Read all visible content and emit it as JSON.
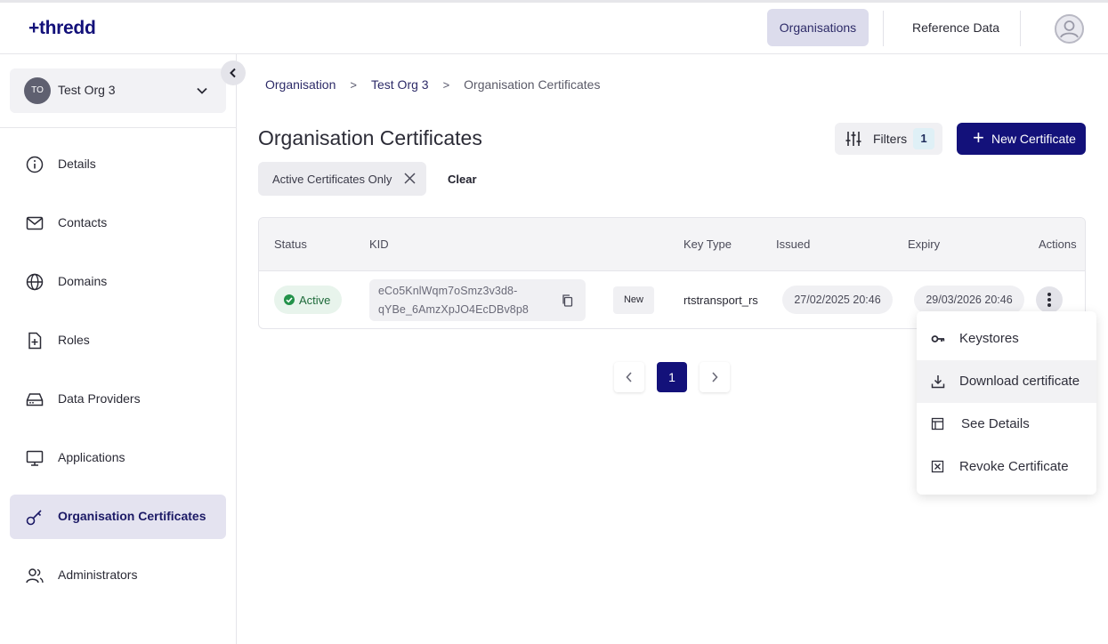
{
  "header": {
    "logo": "+thredd",
    "nav": [
      "Organisations",
      "Reference Data"
    ]
  },
  "sidebar": {
    "org": {
      "initials": "TO",
      "name": "Test Org 3"
    },
    "items": [
      {
        "label": "Details",
        "icon": "info-icon"
      },
      {
        "label": "Contacts",
        "icon": "mail-icon"
      },
      {
        "label": "Domains",
        "icon": "globe-icon"
      },
      {
        "label": "Roles",
        "icon": "document-plus-icon"
      },
      {
        "label": "Data Providers",
        "icon": "drive-icon"
      },
      {
        "label": "Applications",
        "icon": "monitor-icon"
      },
      {
        "label": "Organisation Certificates",
        "icon": "key-icon",
        "active": true
      },
      {
        "label": "Administrators",
        "icon": "users-icon"
      }
    ]
  },
  "breadcrumb": [
    "Organisation",
    "Test Org 3",
    "Organisation Certificates"
  ],
  "page": {
    "title": "Organisation Certificates",
    "filters_label": "Filters",
    "filters_count": "1",
    "new_button": "New Certificate",
    "chip": "Active Certificates Only",
    "clear": "Clear"
  },
  "table": {
    "columns": [
      "Status",
      "KID",
      "Key Type",
      "Issued",
      "Expiry",
      "Actions"
    ],
    "rows": [
      {
        "status": "Active",
        "kid_line1": "eCo5KnlWqm7oSmz3v3d8-",
        "kid_line2": "qYBe_6AmzXpJO4EcDBv8p8",
        "tag": "New",
        "key_type": "rtstransport_rs",
        "issued": "27/02/2025 20:46",
        "expiry": "29/03/2026 20:46"
      }
    ]
  },
  "pagination": {
    "current": "1"
  },
  "menu": [
    "Keystores",
    "Download certificate",
    "See Details",
    "Revoke Certificate"
  ],
  "colors": {
    "brand": "#13117a",
    "active_status": "#23924a"
  }
}
